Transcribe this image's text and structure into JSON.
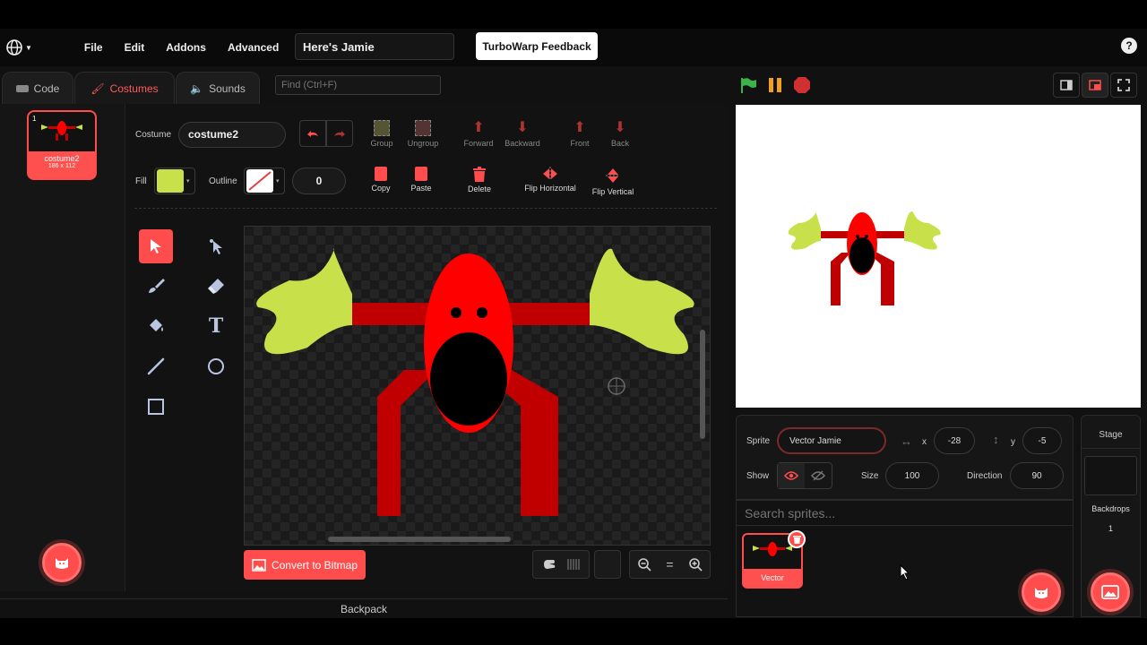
{
  "menubar": {
    "items": [
      "File",
      "Edit",
      "Addons",
      "Advanced"
    ],
    "project_title": "Here's Jamie",
    "feedback_label": "TurboWarp Feedback",
    "help_label": "?"
  },
  "tabs": {
    "code": "Code",
    "costumes": "Costumes",
    "sounds": "Sounds"
  },
  "find": {
    "placeholder": "Find (Ctrl+F)"
  },
  "costume_list": {
    "index": "1",
    "name": "costume2",
    "size": "186 x 112"
  },
  "paint": {
    "costume_label": "Costume",
    "costume_name": "costume2",
    "fill_label": "Fill",
    "outline_label": "Outline",
    "outline_width": "0",
    "fill_color": "#c8e04a",
    "buttons": {
      "group": "Group",
      "ungroup": "Ungroup",
      "forward": "Forward",
      "backward": "Backward",
      "front": "Front",
      "back": "Back",
      "copy": "Copy",
      "paste": "Paste",
      "delete": "Delete",
      "flip_h": "Flip Horizontal",
      "flip_v": "Flip Vertical"
    },
    "convert_label": "Convert to Bitmap",
    "zoom_reset": "="
  },
  "backpack_label": "Backpack",
  "sprite_info": {
    "sprite_label": "Sprite",
    "sprite_name": "Vector Jamie",
    "x_label": "x",
    "x_value": "-28",
    "y_label": "y",
    "y_value": "-5",
    "show_label": "Show",
    "size_label": "Size",
    "size_value": "100",
    "direction_label": "Direction",
    "direction_value": "90"
  },
  "sprite_list": {
    "search_placeholder": "Search sprites...",
    "tile_name": "Vector"
  },
  "stage_panel": {
    "title": "Stage",
    "backdrops_label": "Backdrops",
    "backdrops_count": "1"
  },
  "colors": {
    "accent": "#ff4c4c",
    "character_red": "#ff0000",
    "dark_red": "#c00000",
    "hand_green": "#c8e04a"
  }
}
